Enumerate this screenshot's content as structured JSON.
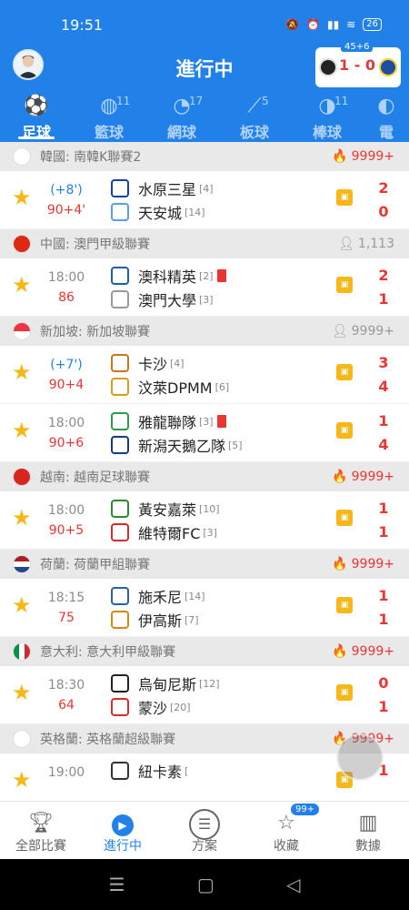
{
  "status": {
    "time": "19:51",
    "battery": "26"
  },
  "header": {
    "title": "進行中"
  },
  "live_card": {
    "minute": "45+6",
    "score": "1 - 0"
  },
  "tabs": [
    {
      "label": "足球",
      "count": "",
      "icon": "soccer-ball-icon",
      "active": true
    },
    {
      "label": "籃球",
      "count": "11",
      "icon": "basketball-icon"
    },
    {
      "label": "網球",
      "count": "17",
      "icon": "tennis-icon"
    },
    {
      "label": "板球",
      "count": "5",
      "icon": "cricket-icon"
    },
    {
      "label": "棒球",
      "count": "11",
      "icon": "baseball-icon"
    },
    {
      "label": "電",
      "count": "",
      "icon": "esports-icon"
    }
  ],
  "leagues": [
    {
      "name": "韓國: 南韓K聯賽2",
      "hot": "9999+",
      "hot_type": "fire",
      "matches": [
        {
          "time": "(+8')",
          "time_live": true,
          "minute": "90+4'",
          "home": "水原三星",
          "home_rank": "[4]",
          "away": "天安城",
          "away_rank": "[14]",
          "home_score": "2",
          "away_score": "0"
        }
      ]
    },
    {
      "name": "中國: 澳門甲級聯賽",
      "hot": "1,113",
      "hot_type": "user",
      "matches": [
        {
          "time": "18:00",
          "minute": "86",
          "home": "澳科精英",
          "home_rank": "[2]",
          "home_red": true,
          "away": "澳門大學",
          "away_rank": "[3]",
          "home_score": "2",
          "away_score": "1"
        }
      ]
    },
    {
      "name": "新加坡: 新加坡聯賽",
      "hot": "9999+",
      "hot_type": "user",
      "matches": [
        {
          "time": "(+7')",
          "time_live": true,
          "minute": "90+4",
          "home": "卡沙",
          "home_rank": "[4]",
          "away": "汶萊DPMM",
          "away_rank": "[6]",
          "home_score": "3",
          "away_score": "4"
        },
        {
          "time": "18:00",
          "minute": "90+6",
          "home": "雅龍聯隊",
          "home_rank": "[3]",
          "home_red": true,
          "away": "新潟天鵝乙隊",
          "away_rank": "[5]",
          "home_score": "1",
          "away_score": "4"
        }
      ]
    },
    {
      "name": "越南: 越南足球聯賽",
      "hot": "9999+",
      "hot_type": "fire",
      "matches": [
        {
          "time": "18:00",
          "minute": "90+5",
          "home": "黃安嘉萊",
          "home_rank": "[10]",
          "away": "維特爾FC",
          "away_rank": "[3]",
          "home_score": "1",
          "away_score": "1"
        }
      ]
    },
    {
      "name": "荷蘭: 荷蘭甲組聯賽",
      "hot": "9999+",
      "hot_type": "fire",
      "matches": [
        {
          "time": "18:15",
          "minute": "75",
          "home": "施禾尼",
          "home_rank": "[14]",
          "away": "伊高斯",
          "away_rank": "[7]",
          "home_score": "1",
          "away_score": "1"
        }
      ]
    },
    {
      "name": "意大利: 意大利甲級聯賽",
      "hot": "9999+",
      "hot_type": "fire",
      "matches": [
        {
          "time": "18:30",
          "minute": "64",
          "home": "烏甸尼斯",
          "home_rank": "[12]",
          "away": "蒙沙",
          "away_rank": "[20]",
          "home_score": "0",
          "away_score": "1"
        }
      ]
    },
    {
      "name": "英格蘭: 英格蘭超級聯賽",
      "hot": "9999+",
      "hot_type": "fire",
      "matches": [
        {
          "time": "19:00",
          "minute": "",
          "home": "紐卡素",
          "home_rank": "[",
          "away": "",
          "away_rank": "",
          "home_score": "1",
          "away_score": ""
        }
      ]
    }
  ],
  "bottom_nav": [
    {
      "label": "全部比賽",
      "icon": "trophy-icon"
    },
    {
      "label": "進行中",
      "icon": "play-icon",
      "active": true
    },
    {
      "label": "方案",
      "icon": "document-icon"
    },
    {
      "label": "收藏",
      "icon": "star-icon",
      "badge": "99+"
    },
    {
      "label": "數據",
      "icon": "chart-icon"
    }
  ],
  "colors": {
    "primary": "#2181e8",
    "score_red": "#e33333",
    "star": "#f6b818"
  }
}
